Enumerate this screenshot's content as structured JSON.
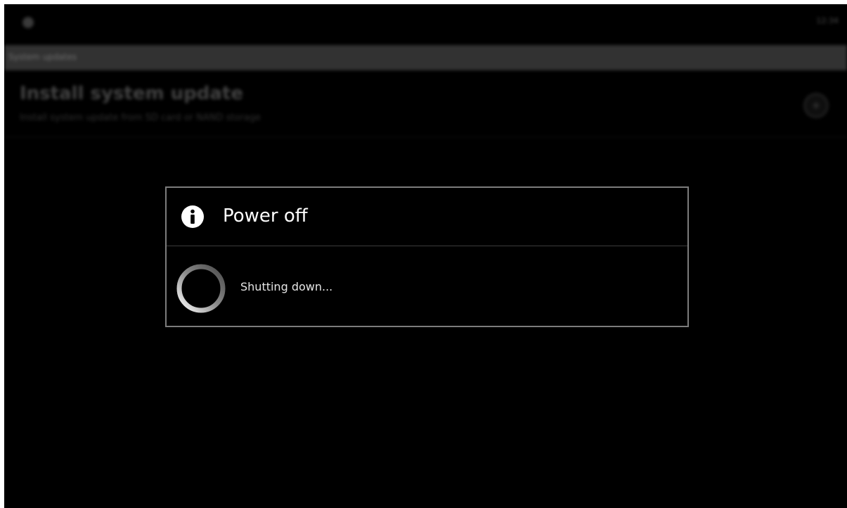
{
  "status_bar": {
    "icon": "usb-icon",
    "time": "12:34"
  },
  "title_bar": {
    "title": "System updates"
  },
  "setting": {
    "title": "Install system update",
    "summary": "Install system update from SD card or NAND storage",
    "icon": "install-icon"
  },
  "dialog": {
    "icon": "info-icon",
    "title": "Power off",
    "message": "Shutting down...",
    "spinner_icon": "progress-spinner-icon"
  },
  "colors": {
    "background": "#000000",
    "dialog_border": "#7c7c7c",
    "text_primary": "#ffffff",
    "text_secondary": "#e6e6e6"
  }
}
